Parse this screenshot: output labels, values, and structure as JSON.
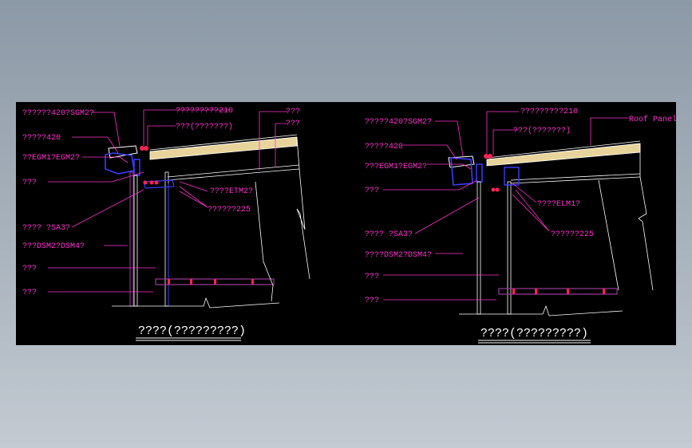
{
  "colors": {
    "background": "#000000",
    "leader": "#ff33cc",
    "outline": "#ffffff",
    "frame": "#9a3c9a",
    "steel": "#3b3bff",
    "insulation": "#e8d49a",
    "bolt": "#ff2255"
  },
  "left": {
    "title": "????(?????????)",
    "labels": {
      "sgm": "??????420?SGM2?",
      "l420": "?????420",
      "egm": "??EGM1?EGM2?",
      "a1": "???",
      "sa3": "???? ?SA3?",
      "dsm": "???DSM2?DSM4?",
      "a2": "???",
      "a3": "???",
      "t210": "?????????210",
      "paren": "???(???????)",
      "r1": "???",
      "r2": "???",
      "etm": "????ETM2?",
      "t225": "??????225"
    }
  },
  "right": {
    "title": "????(?????????)",
    "labels": {
      "sgm": "?????420?SGM2?",
      "l420": "?????420",
      "egm": "???EGM1?EGM2?",
      "a1": "???",
      "sa3": "???? ?SA3?",
      "dsm": "????DSM2?DSM4?",
      "a2": "???",
      "a3": "???",
      "t210": "?????????210",
      "paren": "???(???????)",
      "roof": "Roof Panel",
      "elm": "????ELM1?",
      "t225": "??????225"
    }
  }
}
